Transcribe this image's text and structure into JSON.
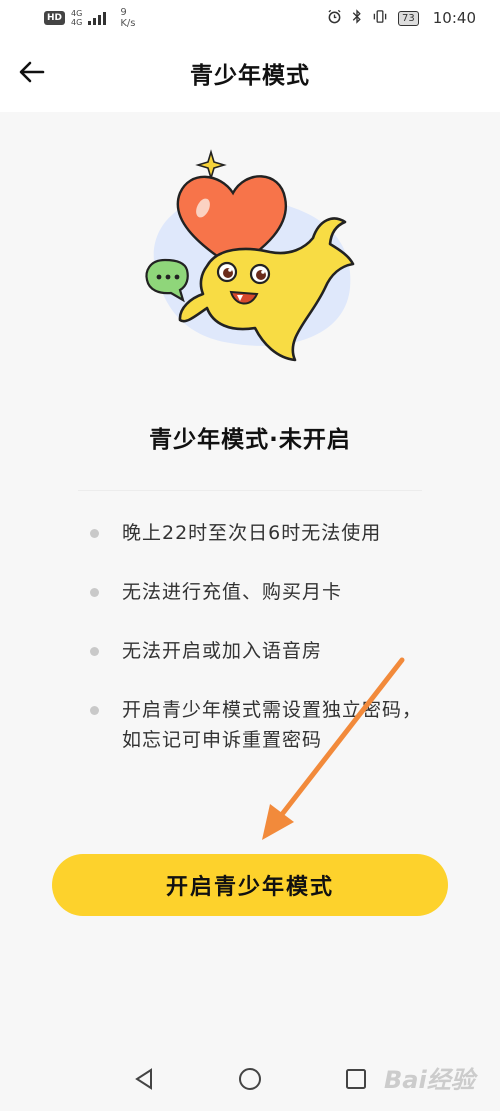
{
  "status_bar": {
    "badge": "HD",
    "network": [
      "4G",
      "4G"
    ],
    "speed_value": "9",
    "speed_unit": "K/s",
    "battery": "73",
    "time": "10:40"
  },
  "header": {
    "title": "青少年模式",
    "back_icon": "arrow-left-icon"
  },
  "main": {
    "status_title": "青少年模式·未开启",
    "rules": [
      "晚上22时至次日6时无法使用",
      "无法进行充值、购买月卡",
      "无法开启或加入语音房",
      "开启青少年模式需设置独立密码，如忘记可申诉重置密码"
    ],
    "cta_label": "开启青少年模式"
  },
  "nav": {
    "back": "triangle-back-icon",
    "home": "circle-home-icon",
    "recent": "square-recent-icon"
  },
  "watermark": "Bai经验",
  "colors": {
    "accent": "#fdd22c",
    "arrow": "#f28a3b",
    "background": "#f7f7f7"
  }
}
